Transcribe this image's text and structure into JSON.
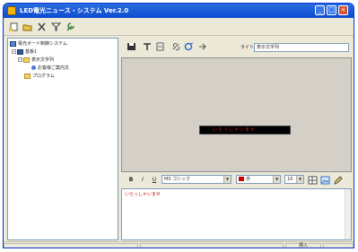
{
  "window": {
    "title": "LED電光ニュース・システム Ver.2.0",
    "buttons": {
      "minimize": "_",
      "maximize": "□",
      "close": "×"
    }
  },
  "toolbar": {
    "items": [
      "new-icon",
      "open-icon",
      "delete-icon",
      "filter-icon",
      "tools-icon"
    ]
  },
  "tree": {
    "root": {
      "label": "電光ボード制御システム",
      "icon": "computer-icon"
    },
    "items": [
      {
        "label": "基板1",
        "icon": "database-icon",
        "expander": "−"
      },
      {
        "label": "表示文字列",
        "icon": "folder-icon",
        "expander": "−"
      },
      {
        "label": "お客様ご案内文",
        "icon": "file-icon"
      },
      {
        "label": "プログラム",
        "icon": "folder-icon"
      }
    ]
  },
  "right_toolbar": {
    "address_label": "タイトル",
    "address_value": "表示文字列"
  },
  "preview": {
    "led_text": "いらっしゃいませ"
  },
  "format_bar": {
    "bold": "B",
    "italic": "I",
    "underline": "U",
    "font": "MS ゴシック",
    "color_label": "赤",
    "size": "16"
  },
  "editor": {
    "text": "いらっしゃいませ"
  },
  "status": {
    "pane": "挿入"
  },
  "colors": {
    "titlebar": "#0d4bcf",
    "led_text": "#d01818",
    "editor_text": "#d01818"
  }
}
